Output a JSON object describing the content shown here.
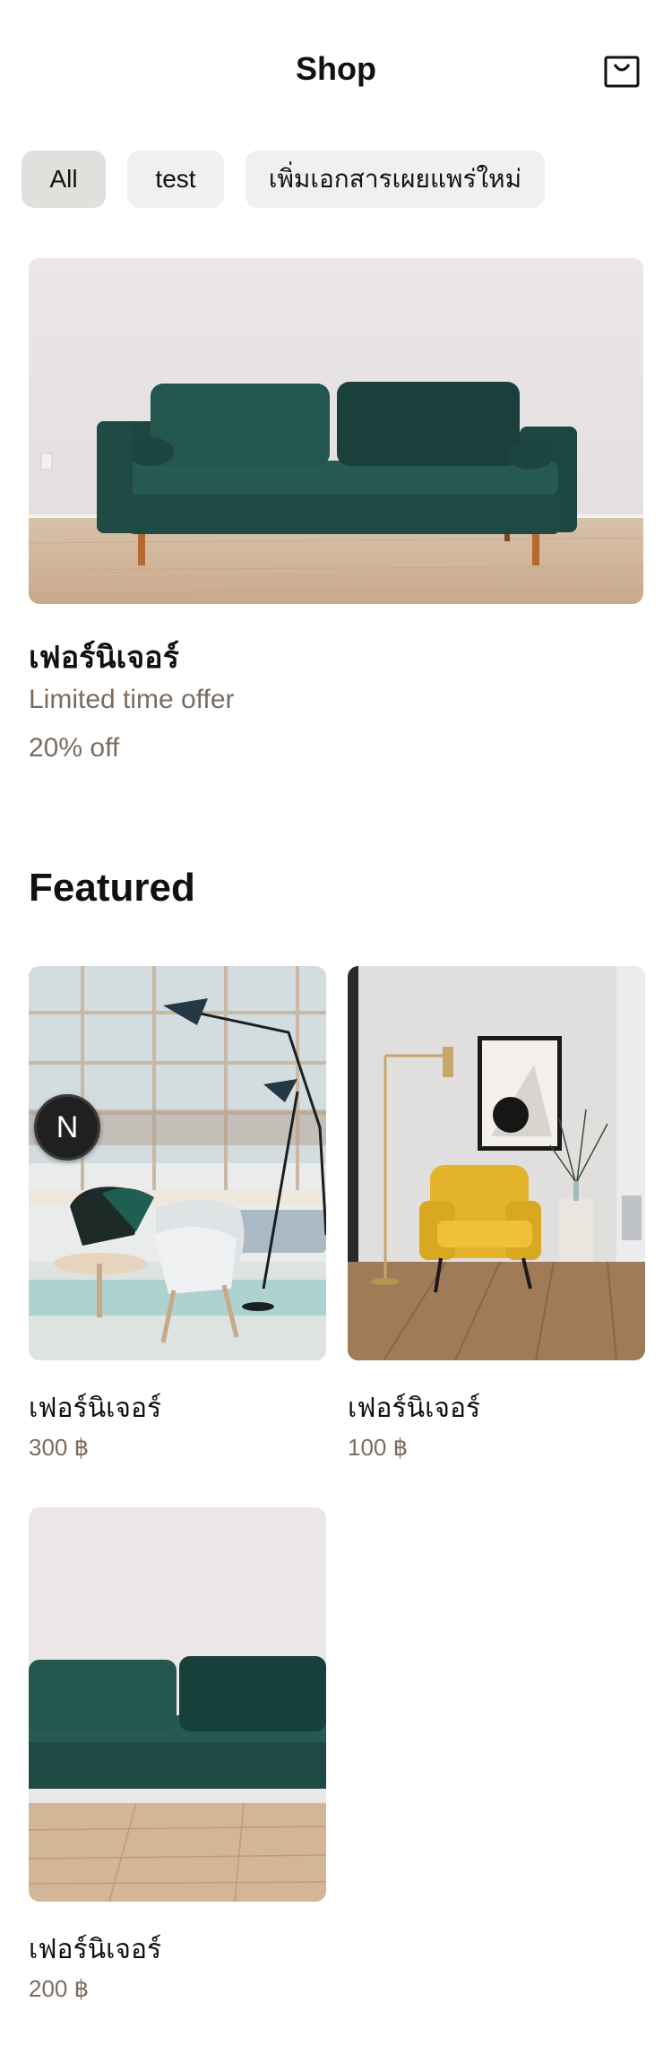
{
  "header": {
    "title": "Shop",
    "cart_icon": "shopping-bag-icon"
  },
  "categories": [
    {
      "label": "All",
      "selected": true
    },
    {
      "label": "test",
      "selected": false
    },
    {
      "label": "เพิ่มเอกสารเผยแพร่ใหม่",
      "selected": false
    }
  ],
  "hero": {
    "title": "เฟอร์นิเจอร์",
    "subtitle": "Limited time offer",
    "discount": "20% off"
  },
  "featured": {
    "heading": "Featured",
    "products": [
      {
        "name": "เฟอร์นิเจอร์",
        "price": "300 ฿"
      },
      {
        "name": "เฟอร์นิเจอร์",
        "price": "100 ฿"
      },
      {
        "name": "เฟอร์นิเจอร์",
        "price": "200 ฿"
      }
    ]
  },
  "dev_badge": {
    "letter": "N"
  },
  "colors": {
    "muted_text": "#7a6c62",
    "chip_bg": "#f1f0ee",
    "chip_active_bg": "#e2e0dc",
    "sofa_green": "#204a45"
  }
}
